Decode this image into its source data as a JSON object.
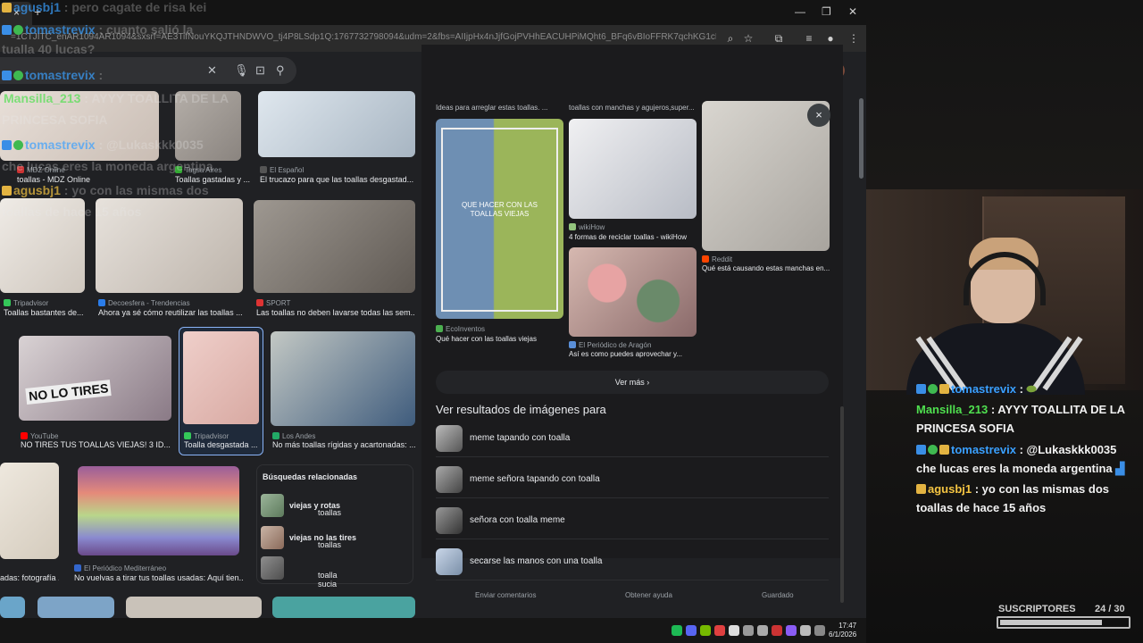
{
  "browser": {
    "address": "=1CTJITC_enAR1094AR1094&sxsrf=AE3TifNouYKQJTHNDWVO_tj4P8LSdp1Q:1767732798094&udm=2&fbs=AIIjpHx4nJjfGojPVHhEACUHPiMQht6_BFq6vBIoFFRK7qchKG1cRgcE0P7z3SNizmlu0...",
    "tab_close": "×",
    "new_tab": "+"
  },
  "left_results": [
    {
      "source": "MDZ Online",
      "caption": "toallas - MDZ Online",
      "color": "#dcd3cc"
    },
    {
      "source": "Tagsa Aires",
      "caption": "Toallas gastadas y ...",
      "color": "#a9a5a0"
    },
    {
      "source": "El Español",
      "caption": "El trucazo para que las toallas desgastad...",
      "color": "#c8d4de"
    },
    {
      "source": "Tripadvisor",
      "caption": "Toallas bastantes de...",
      "color": "#e2ddd7"
    },
    {
      "source": "Decoesfera - Trendencias",
      "caption": "Ahora ya sé cómo reutilizar las toallas ...",
      "color": "#d8d2cc"
    },
    {
      "source": "SPORT",
      "caption": "Las toallas no deben lavarse todas las sem...",
      "color": "#8c8680"
    },
    {
      "source": "YouTube",
      "caption": "NO TIRES TUS TOALLAS VIEJAS! 3 ID...",
      "color": "#b0a3a8",
      "overlay": "NO LO TIRES"
    },
    {
      "source": "Tripadvisor",
      "caption": "Toalla desgastada ...",
      "color": "#e7c8c3"
    },
    {
      "source": "Los Andes",
      "caption": "No más toallas rígidas y acartonadas: ...",
      "color": "#7d93a8"
    },
    {
      "source": "",
      "caption": "adas: fotografía ...",
      "color": "#e3ddd4"
    },
    {
      "source": "El Periódico Mediterráneo",
      "caption": "No vuelvas a tirar tus toallas usadas: Aquí tien...",
      "color": "#8e6a8a"
    }
  ],
  "related": {
    "title": "Búsquedas relacionadas",
    "items": [
      {
        "prefix": "toallas ",
        "bold": "viejas y rotas"
      },
      {
        "prefix": "toallas ",
        "bold": "viejas no las tires"
      },
      {
        "prefix": "toalla sucia",
        "bold": ""
      }
    ]
  },
  "preview": {
    "top_captions": [
      "Ideas para arreglar estas toallas. ...",
      "toallas con manchas y agujeros,super..."
    ],
    "cards": [
      {
        "source": "EcoInventos",
        "caption": "Qué hacer con las toallas viejas",
        "overlay": "QUE HACER CON LAS TOALLAS VIEJAS"
      },
      {
        "source": "wikiHow",
        "caption": "4 formas de reciclar toallas - wikiHow"
      },
      {
        "source": "Reddit",
        "caption": "Qué está causando estas manchas en..."
      },
      {
        "source": "El Periódico de Aragón",
        "caption": "Así es como puedes aprovechar y..."
      }
    ],
    "ver_mas": "Ver más",
    "ver_resultados_title": "Ver resultados de imágenes para",
    "suggestions": [
      "meme tapando con toalla",
      "meme señora tapando con toalla",
      "señora con toalla meme",
      "secarse las manos con una toalla"
    ],
    "footer": [
      "Enviar comentarios",
      "Obtener ayuda",
      "Guardado"
    ],
    "close": "×"
  },
  "taskbar": {
    "time": "17:47",
    "date": "6/1/2026"
  },
  "chat": {
    "faded": [
      {
        "user": "agusbj1",
        "text": " : pero cagate de risa kei"
      },
      {
        "user": "tomastrevix",
        "text": " : cuanto salió la"
      },
      {
        "user": "",
        "text": "tualla 40 lucas?"
      },
      {
        "user": "tomastrevix",
        "text": " : "
      },
      {
        "user": "Mansilla_213",
        "text": " : AYYY TOALLITA DE LA"
      },
      {
        "user": "",
        "text": "PRINCESA SOFIA"
      },
      {
        "user": "tomastrevix",
        "text": " : @Lukaskkk0035"
      },
      {
        "user": "",
        "text": "che lucas eres la moneda argentina"
      },
      {
        "user": "agusbj1",
        "text": " : yo con las mismas dos"
      },
      {
        "user": "",
        "text": "toallas de hace 15 años"
      }
    ],
    "messages": [
      {
        "user": "tomastrevix",
        "text": " : "
      },
      {
        "user": "Mansilla_213",
        "text": " : AYYY TOALLITA DE LA"
      },
      {
        "user": "",
        "text": "PRINCESA SOFIA"
      },
      {
        "user": "tomastrevix",
        "text": " : @Lukaskkk0035"
      },
      {
        "user": "",
        "text": "che lucas eres la moneda argentina"
      },
      {
        "user": "agusbj1",
        "text": " : yo con las mismas dos"
      },
      {
        "user": "",
        "text": "toallas de hace 15 años"
      }
    ]
  },
  "subs": {
    "label": "SUSCRIPTORES",
    "count": "24 / 30",
    "progress": 0.8
  }
}
